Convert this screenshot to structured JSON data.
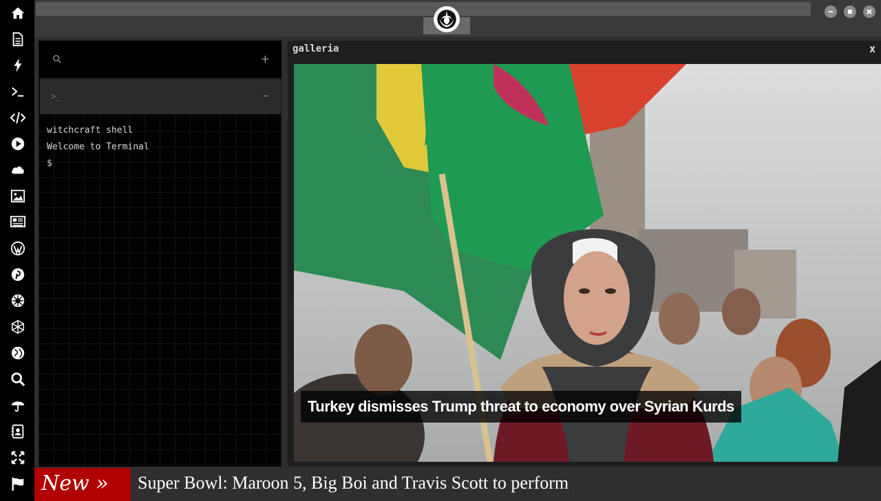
{
  "sidebar": {
    "icons": [
      "home-icon",
      "document-icon",
      "bolt-icon",
      "terminal-icon",
      "code-icon",
      "play-icon",
      "cloud-icon",
      "image-icon",
      "newspaper-icon",
      "wordpress-icon",
      "pinterest-icon",
      "galactic-empire-icon",
      "hexagon-network-icon",
      "globe-icon",
      "search-icon",
      "umbrella-icon",
      "contacts-icon",
      "fullscreen-icon",
      "flag-icon"
    ]
  },
  "terminal": {
    "plus_label": "+",
    "tab_prompt": ">_",
    "minus_label": "–",
    "lines": [
      "witchcraft shell",
      "Welcome to Terminal",
      "$"
    ]
  },
  "gallery": {
    "title": "galleria",
    "close_label": "x",
    "caption": "Turkey dismisses Trump threat to economy over Syrian Kurds"
  },
  "ticker": {
    "badge": "New »",
    "headline": "Super Bowl: Maroon 5, Big Boi and Travis Scott to perform"
  },
  "colors": {
    "sidebar_bg": "#000000",
    "panel_bg": "#1e1e1e",
    "ticker_badge": "#b00000"
  }
}
